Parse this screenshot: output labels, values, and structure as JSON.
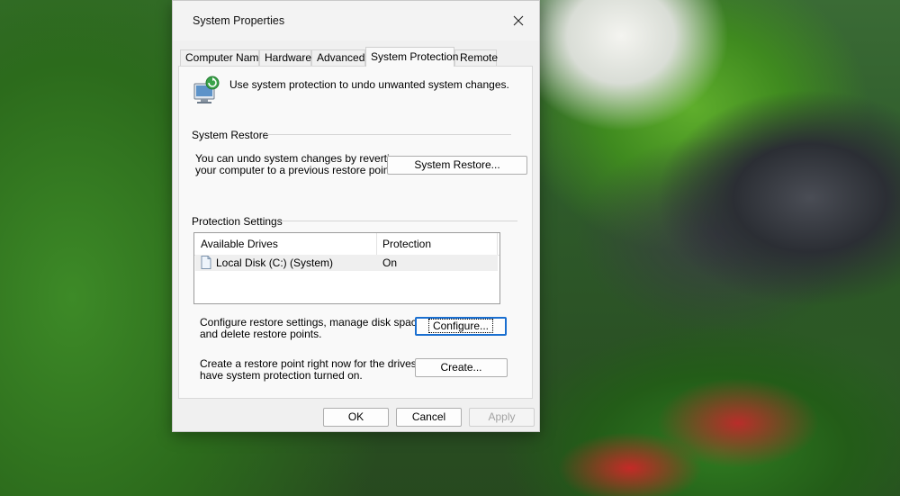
{
  "window": {
    "title": "System Properties"
  },
  "tabs": [
    {
      "label": "Computer Name"
    },
    {
      "label": "Hardware"
    },
    {
      "label": "Advanced"
    },
    {
      "label": "System Protection"
    },
    {
      "label": "Remote"
    }
  ],
  "active_tab": "System Protection",
  "intro": {
    "text": "Use system protection to undo unwanted system changes.",
    "icon": "system-protection-icon"
  },
  "system_restore": {
    "group_label": "System Restore",
    "description_line1": "You can undo system changes by reverting",
    "description_line2": "your computer to a previous restore point.",
    "button_label": "System Restore..."
  },
  "protection_settings": {
    "group_label": "Protection Settings",
    "columns": [
      "Available Drives",
      "Protection"
    ],
    "drives": [
      {
        "name": "Local Disk  (C:) (System)",
        "protection": "On",
        "icon": "drive-icon"
      }
    ],
    "configure_text_line1": "Configure restore settings, manage disk space,",
    "configure_text_line2": "and delete restore points.",
    "configure_button": "Configure...",
    "create_text_line1": "Create a restore point right now for the drives that",
    "create_text_line2": "have system protection turned on.",
    "create_button": "Create..."
  },
  "footer": {
    "ok": "OK",
    "cancel": "Cancel",
    "apply": "Apply"
  },
  "colors": {
    "focus_border": "#1a6fd0",
    "dialog_bg": "#f0f0f0",
    "tab_page_bg": "#f9f9f9"
  }
}
